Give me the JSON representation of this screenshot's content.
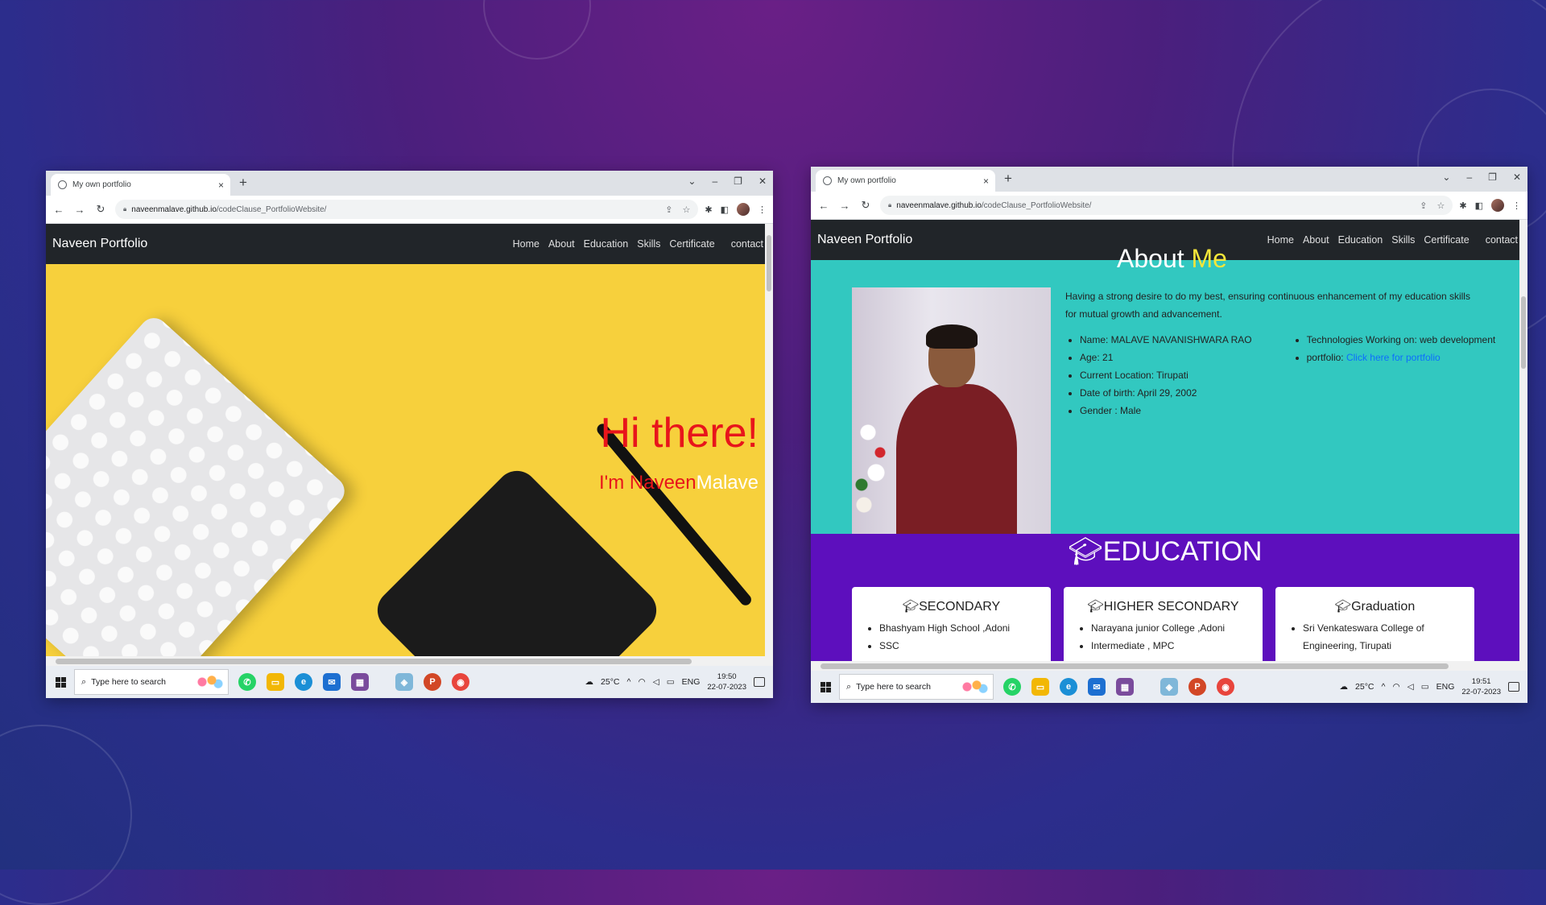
{
  "colors": {
    "slide_bg_top": "#6a1f86",
    "slide_bg_bottom": "#22307f",
    "navbar": "#212529",
    "hero_bg": "#f7d03c",
    "hi_red": "#e8151b",
    "about_bg": "#32c8c0",
    "about_accent": "#f5e63a",
    "education_bg": "#5d0fbd",
    "link_blue": "#0d6efd"
  },
  "screenshots": [
    {
      "browser": {
        "tab_title": "My own portfolio",
        "tab_close": "×",
        "new_tab": "+",
        "url_host": "naveenmalave.github.io",
        "url_path": "/codeClause_PortfolioWebsite/"
      },
      "site": {
        "brand": "Naveen Portfolio",
        "nav": [
          "Home",
          "About",
          "Education",
          "Skills",
          "Certificate",
          "contact"
        ],
        "hero_heading": "Hi there!",
        "hero_intro": "I'm ",
        "hero_first": "Naveen",
        "hero_last": "Malave"
      },
      "taskbar": {
        "search_placeholder": "Type here to search",
        "temperature": "25°C",
        "language": "ENG",
        "time": "19:50",
        "date": "22-07-2023"
      }
    },
    {
      "browser": {
        "tab_title": "My own portfolio",
        "tab_close": "×",
        "new_tab": "+",
        "url_host": "naveenmalave.github.io",
        "url_path": "/codeClause_PortfolioWebsite/"
      },
      "site": {
        "brand": "Naveen Portfolio",
        "nav": [
          "Home",
          "About",
          "Education",
          "Skills",
          "Certificate",
          "contact"
        ],
        "about_title_a": "About ",
        "about_title_b": "Me",
        "about_intro": "Having a strong desire to do my best, ensuring continuous enhancement of my education skills for mutual growth and advancement.",
        "details_left": [
          "Name: MALAVE NAVANISHWARA RAO",
          "Age: 21",
          "Current Location: Tirupati",
          "Date of birth: April 29, 2002",
          "Gender : Male"
        ],
        "details_right_tech": "Technologies Working on: web development",
        "portfolio_label": "portfolio: ",
        "portfolio_link": "Click here for portfolio",
        "education_title": "EDUCATION",
        "cards": [
          {
            "title": "SECONDARY",
            "items": [
              "Bhashyam High School ,Adoni",
              "SSC"
            ]
          },
          {
            "title": "HIGHER SECONDARY",
            "items": [
              "Narayana junior College ,Adoni",
              "Intermediate , MPC"
            ]
          },
          {
            "title": "Graduation",
            "items": [
              "Sri Venkateswara College of Engineering, Tirupati"
            ]
          }
        ]
      },
      "taskbar": {
        "search_placeholder": "Type here to search",
        "temperature": "25°C",
        "language": "ENG",
        "time": "19:51",
        "date": "22-07-2023"
      }
    }
  ]
}
